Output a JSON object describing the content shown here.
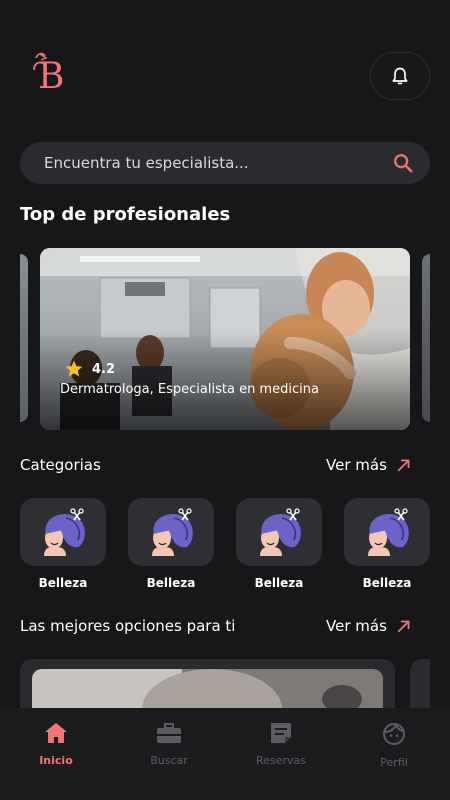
{
  "app": {
    "logo_letter": "B"
  },
  "colors": {
    "accent": "#f07673",
    "background": "#17171a",
    "card": "#2b2b2f",
    "muted": "#5c5c63"
  },
  "header": {
    "bell_icon": "bell-icon"
  },
  "search": {
    "placeholder": "Encuentra tu especialista...",
    "icon": "search-icon"
  },
  "top": {
    "title": "Top de profesionales",
    "card": {
      "rating": "4.2",
      "subtitle": "Dermatrologa, Especialista en medicina"
    }
  },
  "categories": {
    "title": "Categorias",
    "see_more": "Ver más",
    "items": [
      {
        "label": "Belleza",
        "icon": "hair-woman-icon"
      },
      {
        "label": "Belleza",
        "icon": "hair-woman-icon"
      },
      {
        "label": "Belleza",
        "icon": "hair-woman-icon"
      },
      {
        "label": "Belleza",
        "icon": "hair-woman-icon"
      }
    ]
  },
  "recommended": {
    "title": "Las mejores opciones para ti",
    "see_more": "Ver más"
  },
  "tabs": [
    {
      "label": "Inicio",
      "icon": "home-icon",
      "active": true
    },
    {
      "label": "Buscar",
      "icon": "briefcase-icon",
      "active": false
    },
    {
      "label": "Reservas",
      "icon": "notes-icon",
      "active": false
    },
    {
      "label": "Perfil",
      "icon": "face-icon",
      "active": false
    }
  ]
}
